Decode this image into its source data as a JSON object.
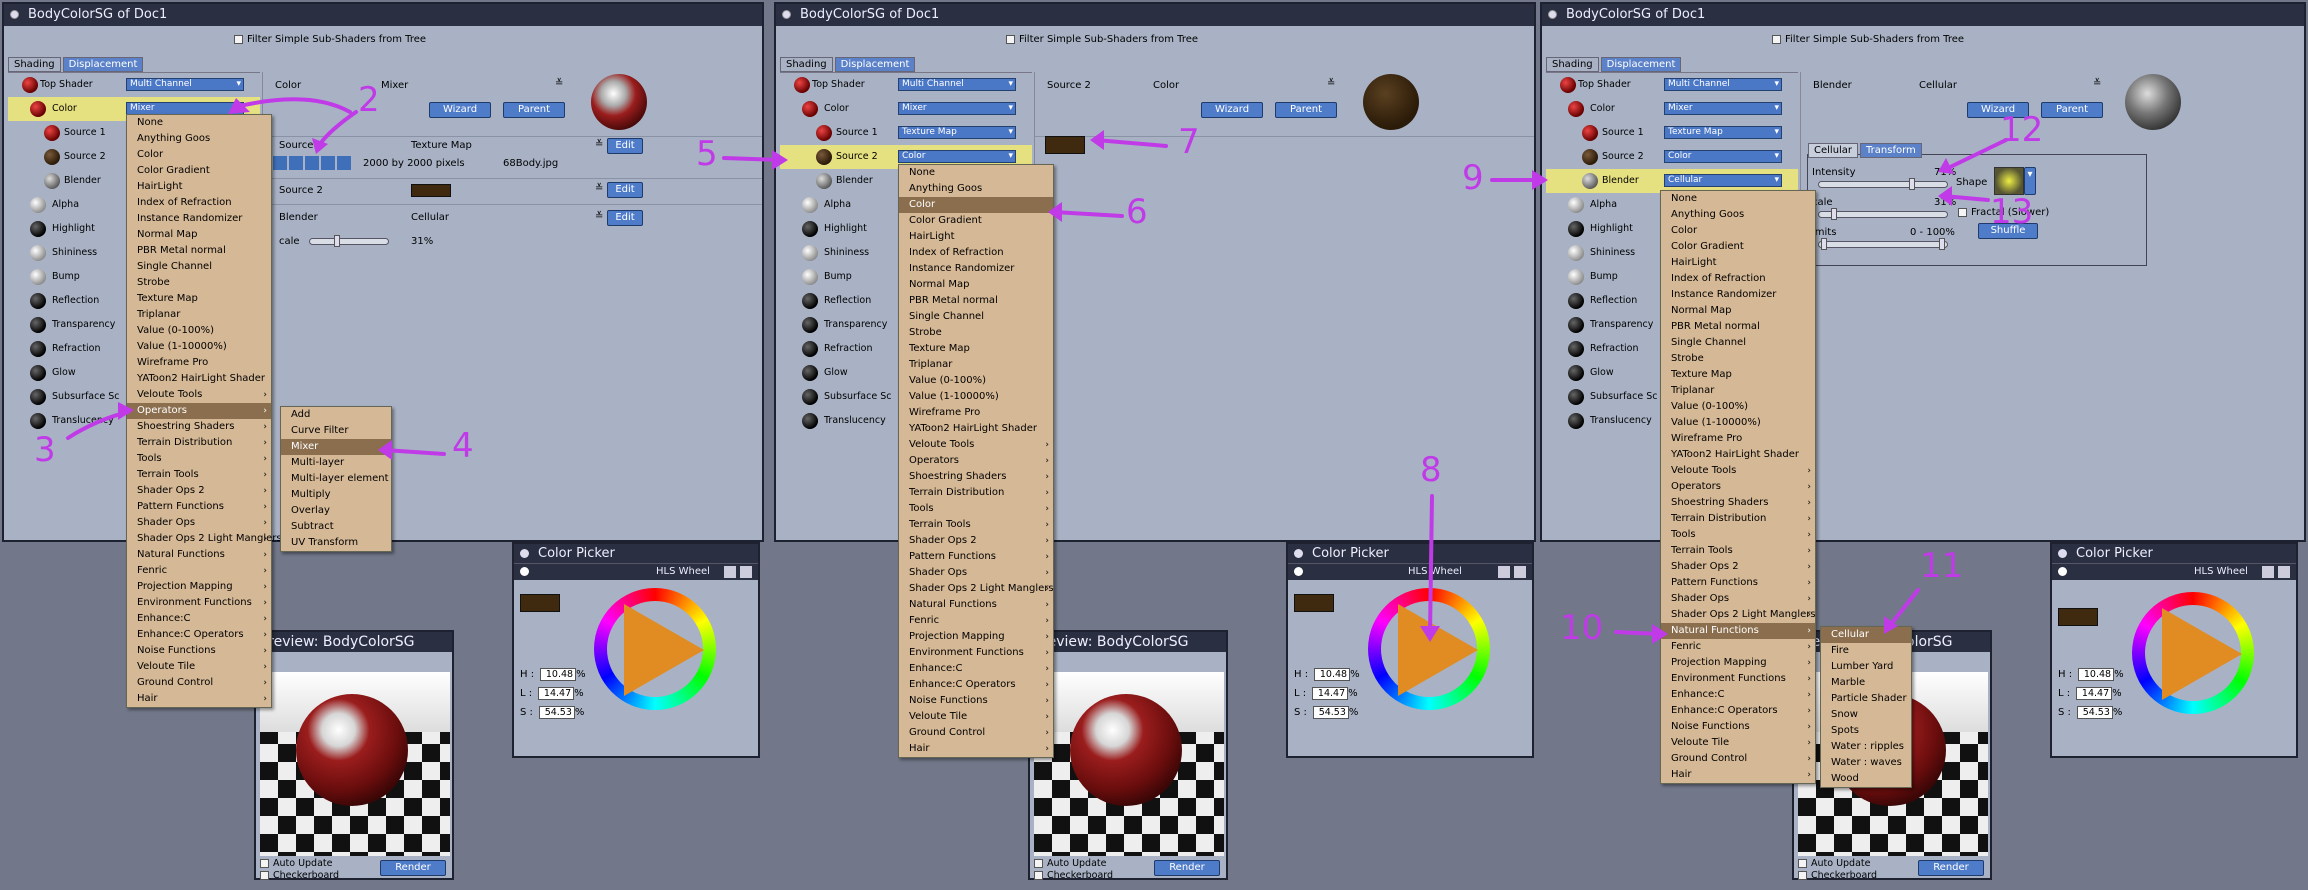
{
  "window_title": "BodyColorSG of Doc1",
  "filter_label": "Filter Simple Sub-Shaders from Tree",
  "tabs": [
    "Shading",
    "Displacement"
  ],
  "tree": {
    "top_shader": "Top Shader",
    "top_value": "Multi Channel",
    "color": "Color",
    "source1": "Source 1",
    "source2": "Source 2",
    "blender": "Blender",
    "channels": [
      "Alpha",
      "Highlight",
      "Shininess",
      "Bump",
      "Reflection",
      "Transparency",
      "Refraction",
      "Glow",
      "Subsurface Sc",
      "Translucency"
    ]
  },
  "values": {
    "mixer": "Mixer",
    "texture_map": "Texture Map",
    "color": "Color",
    "cellular": "Cellular"
  },
  "panel1": {
    "header_left": "Color",
    "header_mid": "Mixer",
    "wizard": "Wizard",
    "parent": "Parent",
    "source_label": "Source 1",
    "source_type": "Texture Map",
    "edit": "Edit",
    "dims": "2000 by 2000 pixels",
    "file": "68Body.jpg",
    "source2_label": "Source 2",
    "blender_label": "Blender",
    "blender_type": "Cellular",
    "scale_label": "cale",
    "scale_value": "31%"
  },
  "panel2": {
    "header_left": "Source 2",
    "header_mid": "Color",
    "wizard": "Wizard",
    "parent": "Parent"
  },
  "panel3": {
    "header_left": "Blender",
    "header_mid": "Cellular",
    "wizard": "Wizard",
    "parent": "Parent",
    "subtabs": [
      "Cellular",
      "Transform"
    ],
    "intensity_label": "Intensity",
    "intensity_value": "71%",
    "shape_label": "Shape",
    "scale_label": "cale",
    "scale_value": "31%",
    "fractal_label": "Fractal (Slower)",
    "shuffle": "Shuffle",
    "limits_label": "imits",
    "limits_value": "0 - 100%"
  },
  "menu_main": [
    "None",
    "Anything Goos",
    "Color",
    "Color Gradient",
    "HairLight",
    "Index of Refraction",
    "Instance Randomizer",
    "Normal Map",
    "PBR Metal normal",
    "Single Channel",
    "Strobe",
    "Texture Map",
    "Triplanar",
    "Value (0-100%)",
    "Value (1-10000%)",
    "Wireframe Pro",
    "YAToon2 HairLight Shader",
    "Veloute Tools",
    "Operators",
    "Shoestring Shaders",
    "Terrain Distribution",
    "Tools",
    "Terrain Tools",
    "Shader Ops 2",
    "Pattern Functions",
    "Shader Ops",
    "Shader Ops 2 Light Manglers",
    "Natural Functions",
    "Fenric",
    "Projection Mapping",
    "Environment Functions",
    "Enhance:C",
    "Enhance:C Operators",
    "Noise Functions",
    "Veloute Tile",
    "Ground Control",
    "Hair"
  ],
  "menu_operators": [
    "Add",
    "Curve Filter",
    "Mixer",
    "Multi-layer",
    "Multi-layer element",
    "Multiply",
    "Overlay",
    "Subtract",
    "UV Transform"
  ],
  "menu_natural": [
    "Cellular",
    "Fire",
    "Lumber Yard",
    "Marble",
    "Particle Shader",
    "Snow",
    "Spots",
    "Water : ripples",
    "Water : waves",
    "Wood"
  ],
  "color_picker": {
    "title": "Color Picker",
    "mode": "HLS Wheel",
    "h_label": "H :",
    "h": "10.48",
    "l_label": "L :",
    "l": "14.47",
    "s_label": "S :",
    "s": "54.53",
    "pct": "%"
  },
  "preview": {
    "title": "Preview: BodyColorSG",
    "auto_update": "Auto Update",
    "checkerboard": "Checkerboard",
    "render": "Render"
  },
  "annotations": [
    "2",
    "3",
    "4",
    "5",
    "6",
    "7",
    "8",
    "9",
    "10",
    "11",
    "12",
    "13"
  ],
  "colors": {
    "annotation": "#c03ae8",
    "menu_bg": "#d5b896",
    "highlight": "#8a6e4e",
    "button": "#4f7cc9"
  }
}
